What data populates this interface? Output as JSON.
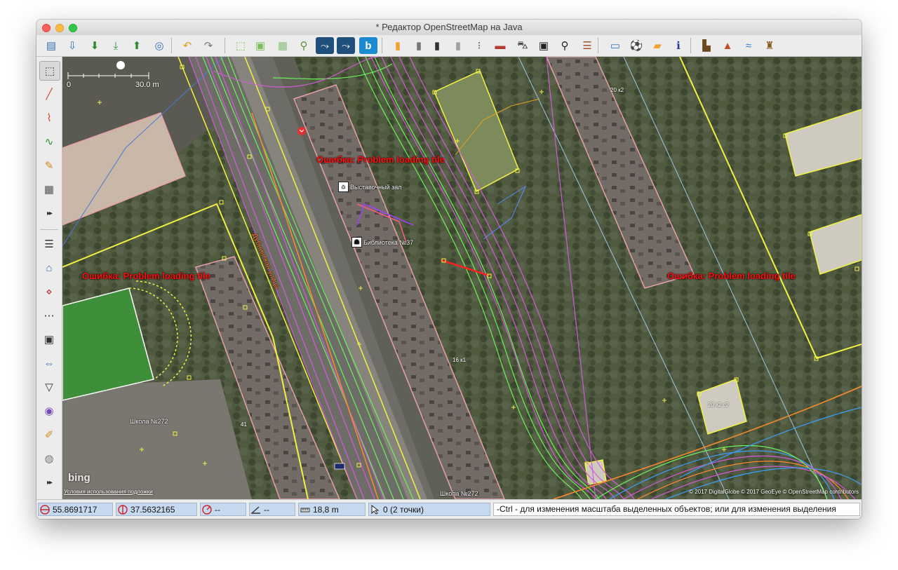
{
  "window": {
    "title": "* Редактор OpenStreetMap на Java"
  },
  "toolbar": {
    "buttons": [
      {
        "icon": "open-file-icon",
        "color": "#3a6fb5"
      },
      {
        "icon": "open-location-icon",
        "color": "#3a6fb5"
      },
      {
        "icon": "save-icon",
        "color": "#2e8b2e"
      },
      {
        "icon": "save-as-icon",
        "color": "#2e8b2e"
      },
      {
        "icon": "upload-icon",
        "color": "#2e8b2e"
      },
      {
        "icon": "preferences-icon",
        "color": "#2f6db5"
      },
      {
        "icon": "undo-icon",
        "color": "#e0a316"
      },
      {
        "icon": "redo-icon",
        "color": "#7a7a7a"
      },
      {
        "icon": "download-area-icon",
        "color": "#7bbf5a"
      },
      {
        "icon": "zoom-to-layer-icon",
        "color": "#7bbf5a"
      },
      {
        "icon": "wms-tms-icon",
        "color": "#8bbf7a"
      },
      {
        "icon": "search-icon",
        "color": "#5e8f3a"
      },
      {
        "icon": "gpx-track-icon",
        "color": "#1f4f7a"
      },
      {
        "icon": "gpx-route-icon",
        "color": "#1f4f7a"
      },
      {
        "icon": "bing-icon",
        "color": "#1b8bd1"
      },
      {
        "icon": "road-orange-icon",
        "color": "#f2a12e"
      },
      {
        "icon": "road-grey-icon",
        "color": "#777777"
      },
      {
        "icon": "road-dark-icon",
        "color": "#333333"
      },
      {
        "icon": "road-light-icon",
        "color": "#a0a0a0"
      },
      {
        "icon": "traffic-signal-icon",
        "color": "#555555"
      },
      {
        "icon": "barrier-wall-icon",
        "color": "#b33b30"
      },
      {
        "icon": "car-icon",
        "color": "#222222"
      },
      {
        "icon": "bus-icon",
        "color": "#222222"
      },
      {
        "icon": "bicycle-icon",
        "color": "#222222"
      },
      {
        "icon": "railway-icon",
        "color": "#a0522d"
      },
      {
        "icon": "hotel-icon",
        "color": "#1f77c9"
      },
      {
        "icon": "football-icon",
        "color": "#222222"
      },
      {
        "icon": "shop-icon",
        "color": "#f2a12e"
      },
      {
        "icon": "information-icon",
        "color": "#1f3f9a"
      },
      {
        "icon": "industrial-icon",
        "color": "#6b4a1f"
      },
      {
        "icon": "peak-icon",
        "color": "#c0501f"
      },
      {
        "icon": "waterway-icon",
        "color": "#2a7fd4"
      },
      {
        "icon": "castle-icon",
        "color": "#8a5a1f"
      }
    ]
  },
  "left_toolbar": {
    "tools": [
      {
        "icon": "select-icon"
      },
      {
        "icon": "draw-line-icon"
      },
      {
        "icon": "draw-node-icon"
      },
      {
        "icon": "improve-way-icon"
      },
      {
        "icon": "draw-pencil-icon"
      },
      {
        "icon": "building-icon"
      },
      {
        "icon": "expand-tools-icon"
      },
      {
        "icon": "layers-icon"
      },
      {
        "icon": "tag-icon"
      },
      {
        "icon": "relation-icon"
      },
      {
        "icon": "selection-list-icon"
      },
      {
        "icon": "photo-icon"
      },
      {
        "icon": "validation-icon"
      },
      {
        "icon": "filter-icon"
      },
      {
        "icon": "map-paint-icon"
      },
      {
        "icon": "history-icon"
      },
      {
        "icon": "location-icon"
      },
      {
        "icon": "expand-panels-icon"
      }
    ]
  },
  "map": {
    "scale": {
      "left_label": "0",
      "right_label": "30.0 m"
    },
    "errors": [
      "Ошибка: Problem loading tile",
      "Ошибка: Problem loading tile",
      "Ошибка: Problem loading tile"
    ],
    "poi": {
      "exhibition": "Выставочный зал",
      "library": "Библиотека №37",
      "school_a": "Школа №272",
      "school_b": "Школа №272",
      "street": "Дубнинская улица"
    },
    "buildings": {
      "b1": "20 к2",
      "b2": "16 к1",
      "b3": "20 к2 с2",
      "b4": "41"
    },
    "bing_logo": "bing",
    "terms_link": "Условия использования подложки",
    "attribution": "© 2017 DigitalGlobe © 2017 GeoEye © OpenStreetMap contributors"
  },
  "status": {
    "latitude": "55.8691717",
    "longitude": "37.5632165",
    "heading": "--",
    "angle": "--",
    "distance": "18,8 m",
    "selection": "0 (2 точки)",
    "message": "-Ctrl - для изменения масштаба выделенных объектов; или для изменения выделения"
  },
  "colors": {
    "track_magenta": "#d35bd8",
    "track_green": "#6cf25a",
    "track_orange": "#ff8a2a",
    "track_blue": "#3aa0ff",
    "boundary_yellow": "#f2f244",
    "building_outline": "#e8a0a8",
    "error_red": "#ff1010",
    "status_field": "#c7d9ee"
  }
}
